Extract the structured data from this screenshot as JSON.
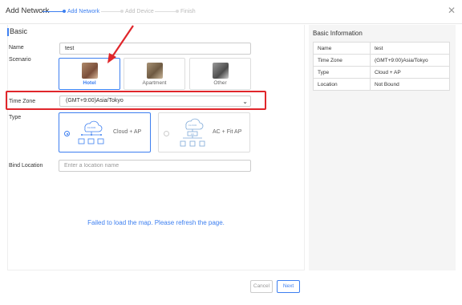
{
  "header": {
    "title": "Add Network",
    "steps": [
      "Add Network",
      "Add Device",
      "Finish"
    ],
    "close_icon": "close-icon"
  },
  "form": {
    "section_title": "Basic",
    "name_label": "Name",
    "name_value": "test",
    "scenario_label": "Scenario",
    "scenarios": [
      "Hotel",
      "Apartment",
      "Other"
    ],
    "selected_scenario": "Hotel",
    "timezone_label": "Time Zone",
    "timezone_value": "(GMT+9:00)Asia/Tokyo",
    "type_label": "Type",
    "types": [
      "Cloud + AP",
      "AC + Fit AP"
    ],
    "cloud_text": "CLOUD",
    "ac_text": "AC",
    "bind_location_label": "Bind Location",
    "bind_location_placeholder": "Enter a location name",
    "map_error": "Failed to load the map. Please refresh the page."
  },
  "buttons": {
    "cancel": "Cancel",
    "next": "Next"
  },
  "info": {
    "title": "Basic Information",
    "rows": [
      {
        "key": "Name",
        "value": "test"
      },
      {
        "key": "Time Zone",
        "value": "(GMT+9:00)Asia/Tokyo"
      },
      {
        "key": "Type",
        "value": "Cloud + AP"
      },
      {
        "key": "Location",
        "value": "Not Bound"
      }
    ]
  },
  "colors": {
    "accent": "#3d7ff0",
    "highlight": "#e0262b"
  }
}
